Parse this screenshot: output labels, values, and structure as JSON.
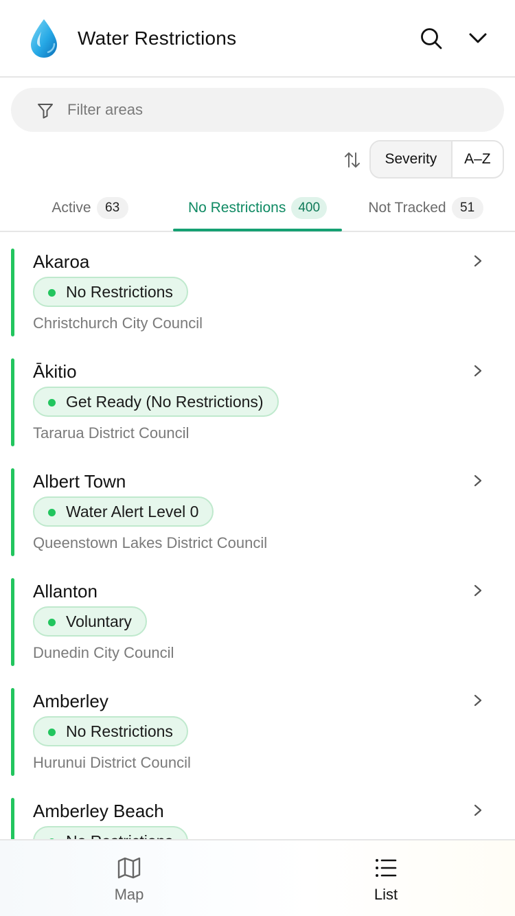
{
  "header": {
    "title": "Water Restrictions",
    "logo_icon": "water-drop-icon",
    "search_icon": "search-icon",
    "menu_icon": "chevron-down-icon"
  },
  "filter": {
    "placeholder": "Filter areas",
    "icon": "filter-icon"
  },
  "sort": {
    "icon": "sort-icon",
    "options": [
      "Severity",
      "A–Z"
    ],
    "selected": "Severity"
  },
  "tabs": [
    {
      "label": "Active",
      "count": "63"
    },
    {
      "label": "No Restrictions",
      "count": "400"
    },
    {
      "label": "Not Tracked",
      "count": "51"
    }
  ],
  "active_tab": "No Restrictions",
  "items": [
    {
      "name": "Akaroa",
      "status": "No Restrictions",
      "council": "Christchurch City Council"
    },
    {
      "name": "Ākitio",
      "status": "Get Ready (No Restrictions)",
      "council": "Tararua District Council"
    },
    {
      "name": "Albert Town",
      "status": "Water Alert Level 0",
      "council": "Queenstown Lakes District Council"
    },
    {
      "name": "Allanton",
      "status": "Voluntary",
      "council": "Dunedin City Council"
    },
    {
      "name": "Amberley",
      "status": "No Restrictions",
      "council": "Hurunui District Council"
    },
    {
      "name": "Amberley Beach",
      "status": "No Restrictions",
      "council": ""
    }
  ],
  "bottom_nav": [
    {
      "label": "Map",
      "icon": "map-icon"
    },
    {
      "label": "List",
      "icon": "list-icon"
    }
  ],
  "colors": {
    "accent": "#15a073",
    "status_green": "#22c55e",
    "badge_bg": "#e6f7ec"
  }
}
